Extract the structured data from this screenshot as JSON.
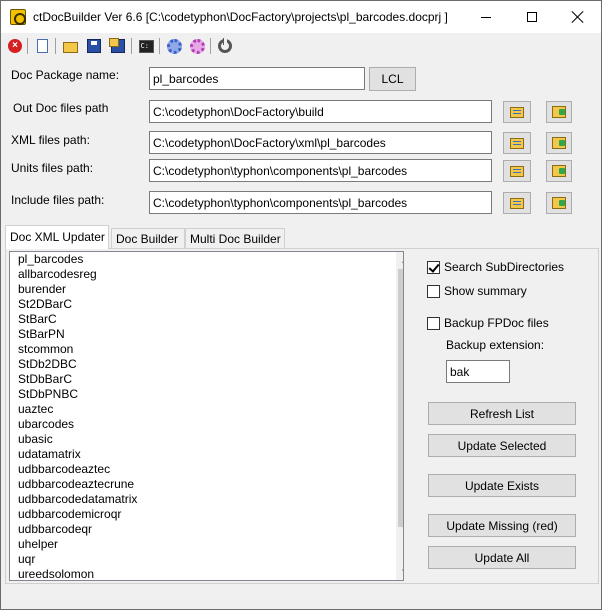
{
  "window": {
    "title": "ctDocBuilder Ver 6.6 [C:\\codetyphon\\DocFactory\\projects\\pl_barcodes.docprj ]"
  },
  "toolbar": {
    "icons": [
      "close-project-icon",
      "new-document-icon",
      "open-folder-icon",
      "save-icon",
      "save-as-icon",
      "console-icon",
      "build-gear-icon",
      "options-gear-icon",
      "power-icon"
    ]
  },
  "form": {
    "package_label": "Doc Package name:",
    "package_value": "pl_barcodes",
    "lcl_button": "LCL",
    "out_label": "Out Doc files path",
    "out_value": "C:\\codetyphon\\DocFactory\\build",
    "xml_label": "XML files path:",
    "xml_value": "C:\\codetyphon\\DocFactory\\xml\\pl_barcodes",
    "units_label": "Units files path:",
    "units_value": "C:\\codetyphon\\typhon\\components\\pl_barcodes",
    "include_label": "Include files path:",
    "include_value": "C:\\codetyphon\\typhon\\components\\pl_barcodes"
  },
  "tabs": [
    {
      "label": "Doc XML Updater"
    },
    {
      "label": "Doc Builder"
    },
    {
      "label": "Multi Doc Builder"
    }
  ],
  "units_list": [
    "pl_barcodes",
    "allbarcodesreg",
    "burender",
    "St2DBarC",
    "StBarC",
    "StBarPN",
    "stcommon",
    "StDb2DBC",
    "StDbBarC",
    "StDbPNBC",
    "uaztec",
    "ubarcodes",
    "ubasic",
    "udatamatrix",
    "udbbarcodeaztec",
    "udbbarcodeaztecrune",
    "udbbarcodedatamatrix",
    "udbbarcodemicroqr",
    "udbbarcodeqr",
    "uhelper",
    "uqr",
    "ureedsolomon"
  ],
  "options": {
    "search_subdirs": {
      "label": "Search SubDirectories",
      "checked": true
    },
    "show_summary": {
      "label": "Show summary",
      "checked": false
    },
    "backup_fpdoc": {
      "label": "Backup FPDoc files",
      "checked": false
    },
    "backup_ext_label": "Backup extension:",
    "backup_ext_value": "bak"
  },
  "actions": {
    "refresh": "Refresh List",
    "update_selected": "Update Selected",
    "update_exists": "Update Exists",
    "update_missing": "Update Missing (red)",
    "update_all": "Update All"
  }
}
